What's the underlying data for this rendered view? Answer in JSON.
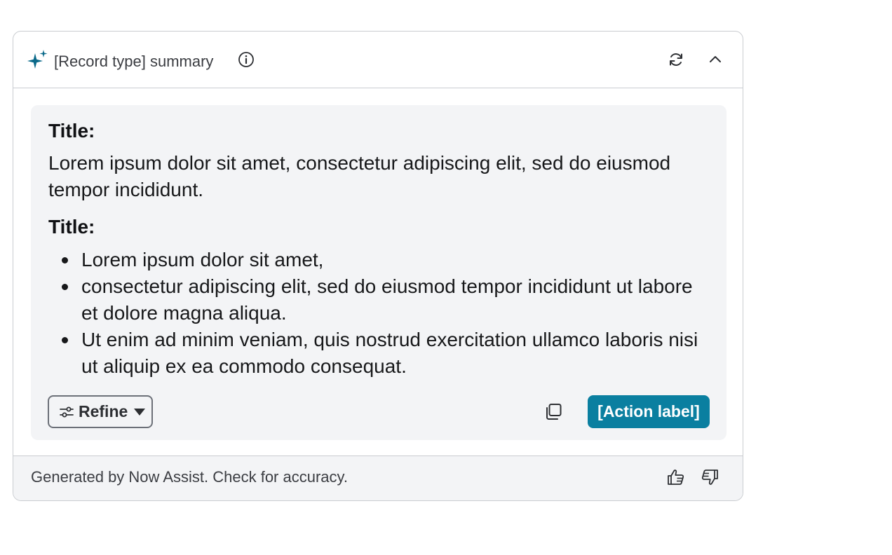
{
  "header": {
    "title": "[Record type] summary",
    "icons": [
      "sparkle-icon",
      "info-icon",
      "refresh-icon",
      "chevron-up-icon"
    ]
  },
  "content": {
    "section1": {
      "title": "Title:",
      "text": "Lorem ipsum dolor sit amet, consectetur adipiscing elit, sed do eiusmod tempor incididunt."
    },
    "section2": {
      "title": "Title:",
      "bullets": [
        "Lorem ipsum dolor sit amet,",
        "consectetur adipiscing elit, sed do eiusmod tempor incididunt ut labore et dolore magna aliqua.",
        "Ut enim ad minim veniam, quis nostrud exercitation ullamco laboris nisi ut aliquip ex ea commodo consequat."
      ]
    },
    "refine_label": "Refine",
    "action_label": "[Action label]"
  },
  "footer": {
    "text": "Generated by Now Assist. Check for accuracy."
  },
  "colors": {
    "accent": "#0a7fa0",
    "sparkle": "#0b6a8a",
    "panel_bg": "#f3f4f6",
    "border": "#c9ccd0"
  }
}
